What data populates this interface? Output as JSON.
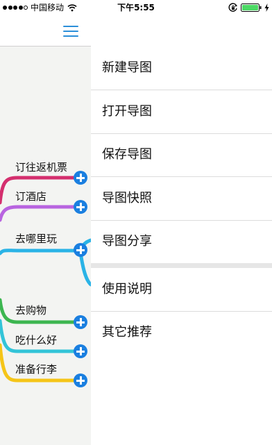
{
  "status_bar": {
    "carrier": "中国移动",
    "time": "下午5:55"
  },
  "mind_map": {
    "branches": [
      {
        "label": "订往返机票",
        "color": "#d42f6e"
      },
      {
        "label": "订酒店",
        "color": "#b864e0"
      },
      {
        "label": "去哪里玩",
        "color": "#2ab3e6"
      },
      {
        "label": "去购物",
        "color": "#3cb650"
      },
      {
        "label": "吃什么好",
        "color": "#33c4d8"
      },
      {
        "label": "准备行李",
        "color": "#f5c518"
      }
    ]
  },
  "menu": {
    "primary_items": [
      "新建导图",
      "打开导图",
      "保存导图",
      "导图快照",
      "导图分享"
    ],
    "secondary_items": [
      "使用说明",
      "其它推荐"
    ]
  },
  "colors": {
    "accent": "#1a7fe0",
    "map_background": "#f3f4f2"
  }
}
